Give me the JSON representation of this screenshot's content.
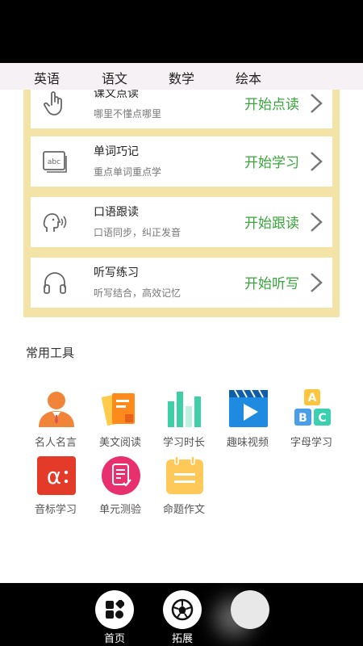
{
  "tabs": [
    "英语",
    "语文",
    "数学",
    "绘本"
  ],
  "cards": [
    {
      "title": "课文点读",
      "subtitle": "哪里不懂点哪里",
      "action": "开始点读",
      "icon": "hand-tap-icon"
    },
    {
      "title": "单词巧记",
      "subtitle": "重点单词重点学",
      "action": "开始学习",
      "icon": "abc-cards-icon"
    },
    {
      "title": "口语跟读",
      "subtitle": "口语同步，纠正发音",
      "action": "开始跟读",
      "icon": "speaking-head-icon"
    },
    {
      "title": "听写练习",
      "subtitle": "听写结合，高效记忆",
      "action": "开始听写",
      "icon": "headphones-icon"
    }
  ],
  "tools_section_title": "常用工具",
  "tools": [
    {
      "label": "名人名言",
      "icon": "person-icon",
      "color": "#f0853a"
    },
    {
      "label": "美文阅读",
      "icon": "cards-icon",
      "color": "#ff8a1c"
    },
    {
      "label": "学习时长",
      "icon": "bar-chart-icon",
      "color": "#3ecfa6"
    },
    {
      "label": "趣味视频",
      "icon": "video-play-icon",
      "color": "#1e8be0"
    },
    {
      "label": "字母学习",
      "icon": "abc-blocks-icon",
      "color": "#47c6d8"
    },
    {
      "label": "音标学习",
      "icon": "alpha-phonetic-icon",
      "color": "#e33a2a"
    },
    {
      "label": "单元测验",
      "icon": "quiz-icon",
      "color": "#e8306e"
    },
    {
      "label": "命题作文",
      "icon": "calendar-note-icon",
      "color": "#ffc95a"
    }
  ],
  "bottom_nav": [
    {
      "label": "首页",
      "icon": "home-grid-icon"
    },
    {
      "label": "拓展",
      "icon": "football-icon"
    },
    {
      "label": "",
      "icon": "circle-icon"
    }
  ],
  "colors": {
    "accent_green": "#39a53b",
    "panel_yellow": "#f4e3a6"
  }
}
